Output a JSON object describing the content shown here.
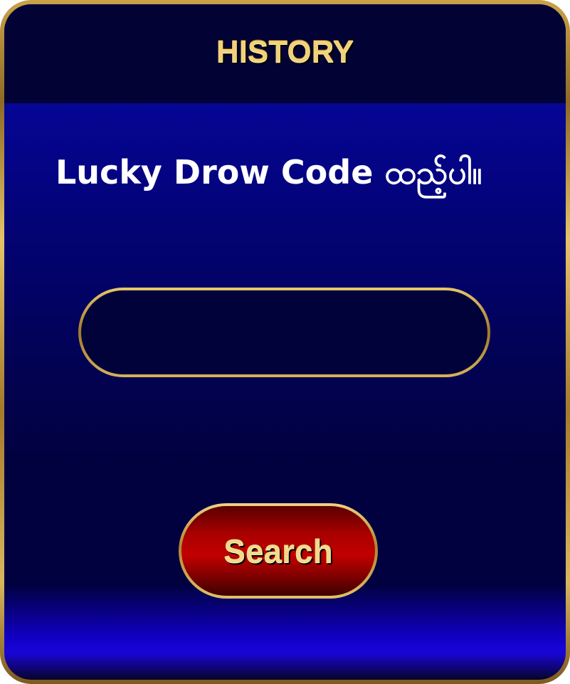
{
  "header": {
    "title": "HISTORY"
  },
  "main": {
    "prompt": "Lucky Drow Code ထည့်ပါ။",
    "code_input": {
      "value": "",
      "placeholder": ""
    },
    "search_label": "Search"
  },
  "colors": {
    "gold": "#e3c36a",
    "header_bg": "#020234",
    "panel_blue": "#06069a",
    "input_bg": "#02023b",
    "button_red": "#b00000"
  }
}
